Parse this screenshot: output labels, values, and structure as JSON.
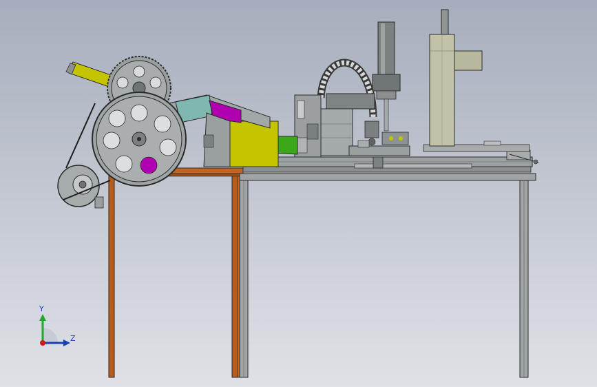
{
  "viewport": {
    "background_top": "#a6aebd",
    "background_bottom": "#dfe1e6"
  },
  "triad": {
    "y_label": "Y",
    "z_label": "Z",
    "y_axis_color": "#22a82c",
    "z_axis_color": "#1e3fb0",
    "origin_color": "#d01818"
  },
  "colors": {
    "steel": "#8b9091",
    "steel_light": "#a9adae",
    "steel_dark": "#5d6263",
    "wood_frame": "#b85c1c",
    "yellow_part": "#c4c400",
    "magenta_part": "#b000b0",
    "green_part": "#3aa818",
    "teal_part": "#7fb8b0",
    "beige_column": "#c2c2a8",
    "outline": "#2a2a2a"
  },
  "icons": {
    "triad": "xyz-axis-triad-icon"
  }
}
